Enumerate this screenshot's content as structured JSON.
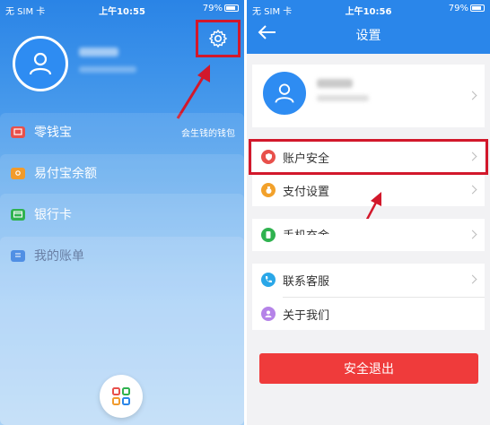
{
  "left": {
    "status": {
      "carrier": "无 SIM 卡",
      "time": "上午10:55",
      "battery": "79%"
    },
    "menu": [
      {
        "label": "零钱宝",
        "subtitle": "会生钱的钱包",
        "icon": "wallet-icon",
        "color": "#e8504b"
      },
      {
        "label": "易付宝余额",
        "icon": "camera-icon",
        "color": "#f29b2b"
      },
      {
        "label": "银行卡",
        "icon": "bank-card-icon",
        "color": "#2fb24f"
      },
      {
        "label": "我的账单",
        "icon": "bill-icon",
        "color": "#3a7fe0"
      }
    ],
    "bottom_icon": "grid-apps-icon"
  },
  "right": {
    "status": {
      "carrier": "无 SIM 卡",
      "time": "上午10:56",
      "battery": "79%"
    },
    "title": "设置",
    "group1": [
      {
        "label": "账户安全",
        "icon": "shield-icon",
        "color": "#e8504b"
      },
      {
        "label": "支付设置",
        "icon": "money-bag-icon",
        "color": "#f2a12b"
      }
    ],
    "group2": [
      {
        "label": "手机充金",
        "icon": "phone-icon",
        "color": "#2fb24f"
      }
    ],
    "group3": [
      {
        "label": "联系客服",
        "icon": "phone-handset-icon",
        "color": "#2aa7e8"
      },
      {
        "label": "关于我们",
        "icon": "user-circle-icon",
        "color": "#b583e8"
      }
    ],
    "logout_label": "安全退出"
  },
  "colors": {
    "primary": "#2a86ea",
    "highlight": "#d2182b",
    "logout": "#ef3b3b"
  }
}
